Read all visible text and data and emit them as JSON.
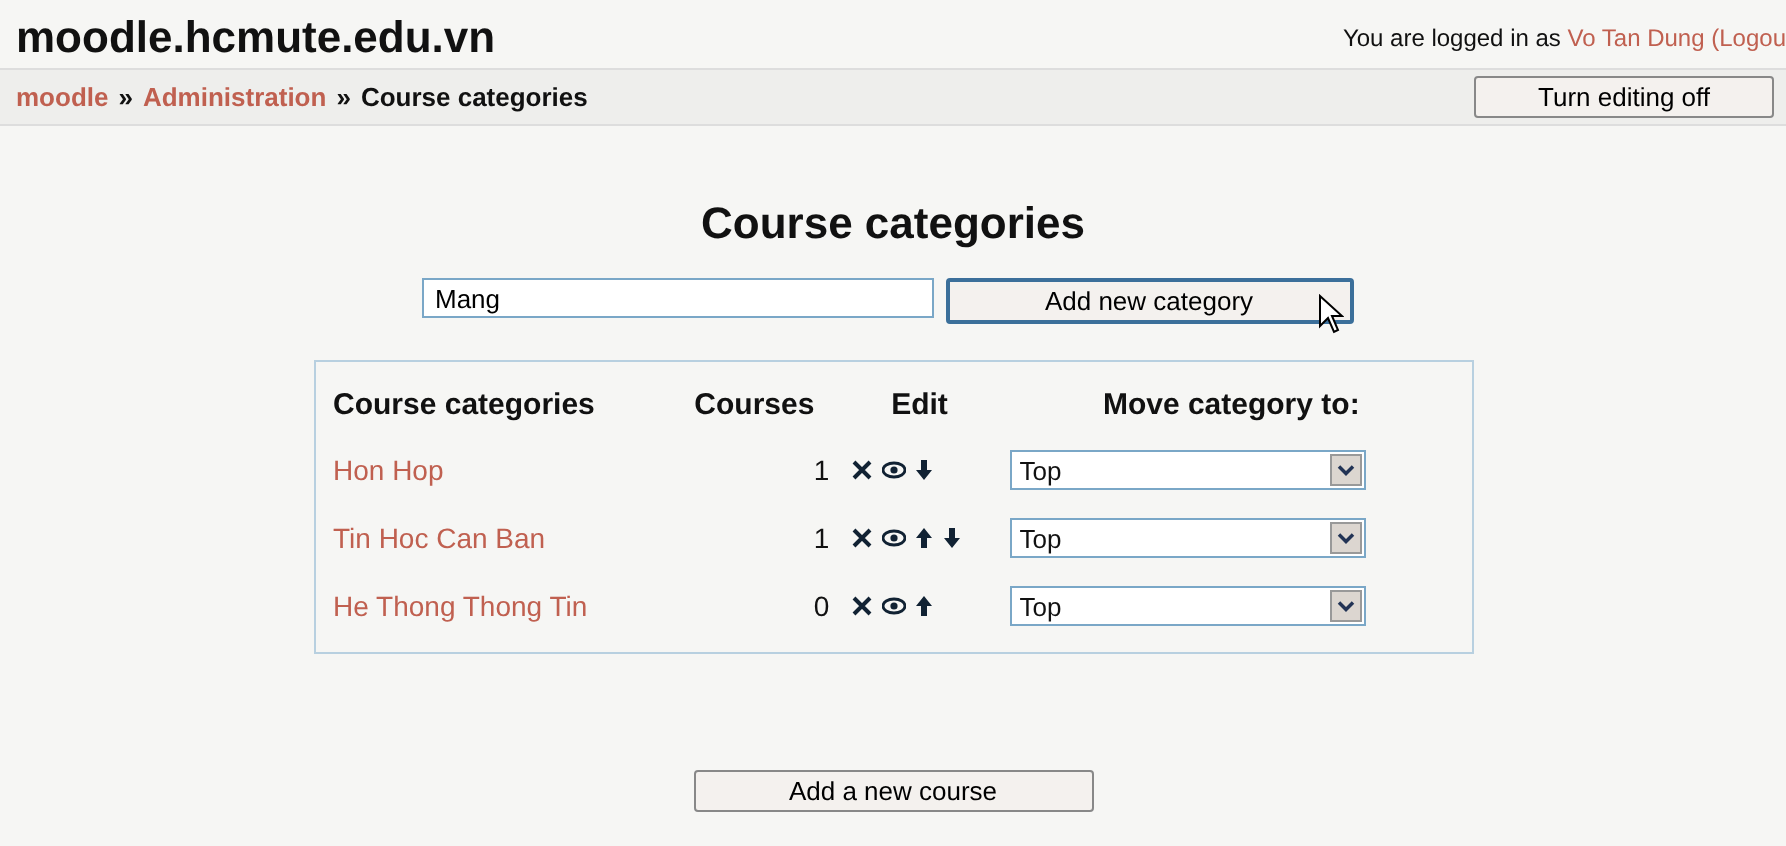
{
  "site_title": "moodle.hcmute.edu.vn",
  "login": {
    "prefix": "You are logged in as",
    "user": "Vo Tan Dung",
    "logout": "(Logou"
  },
  "breadcrumb_separator": "»",
  "breadcrumb": [
    {
      "label": "moodle",
      "link": true
    },
    {
      "label": "Administration",
      "link": true
    },
    {
      "label": "Course categories",
      "link": false
    }
  ],
  "editing_button": "Turn editing off",
  "heading": "Course categories",
  "new_category": {
    "value": "Mang",
    "button": "Add new category"
  },
  "table": {
    "columns": [
      "Course categories",
      "Courses",
      "Edit",
      "Move category to:"
    ],
    "rows": [
      {
        "name": "Hon Hop",
        "courses": "1",
        "actions": [
          {
            "kind": "delete"
          },
          {
            "kind": "hide"
          },
          {
            "kind": "down"
          }
        ],
        "move_to": "Top"
      },
      {
        "name": "Tin Hoc Can Ban",
        "courses": "1",
        "actions": [
          {
            "kind": "delete"
          },
          {
            "kind": "hide"
          },
          {
            "kind": "up"
          },
          {
            "kind": "down"
          }
        ],
        "move_to": "Top"
      },
      {
        "name": "He Thong Thong Tin",
        "courses": "0",
        "actions": [
          {
            "kind": "delete"
          },
          {
            "kind": "hide"
          },
          {
            "kind": "up"
          }
        ],
        "move_to": "Top"
      }
    ]
  },
  "add_course_button": "Add a new course"
}
